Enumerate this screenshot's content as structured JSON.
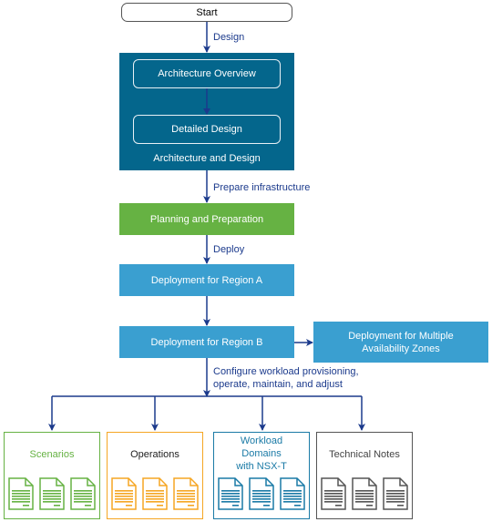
{
  "flow": {
    "start": "Start",
    "edge_design": "Design",
    "architecture_group": {
      "caption": "Architecture and Design",
      "overview": "Architecture Overview",
      "detailed": "Detailed Design"
    },
    "edge_prepare": "Prepare infrastructure",
    "planning": "Planning and Preparation",
    "edge_deploy": "Deploy",
    "region_a": "Deployment for Region A",
    "region_b": "Deployment for Region B",
    "multi_az_line1": "Deployment for Multiple",
    "multi_az_line2": "Availability Zones",
    "edge_configure_line1": "Configure workload provisioning,",
    "edge_configure_line2": "operate, maintain, and adjust"
  },
  "doc_sets": [
    {
      "title_lines": [
        "Scenarios"
      ],
      "color": "#66b243",
      "text_color": "#66b243",
      "icon": "document-icon"
    },
    {
      "title_lines": [
        "Operations"
      ],
      "color": "#f5a623",
      "text_color": "#222222",
      "icon": "document-icon"
    },
    {
      "title_lines": [
        "Workload",
        "Domains",
        "with NSX-T"
      ],
      "color": "#1a7aa6",
      "text_color": "#1a7aa6",
      "icon": "document-icon"
    },
    {
      "title_lines": [
        "Technical Notes"
      ],
      "color": "#555555",
      "text_color": "#444444",
      "icon": "document-icon"
    }
  ],
  "colors": {
    "arrow": "#1b3a8c",
    "architecture": "#04668c",
    "planning": "#66b243",
    "deployment": "#3a9fd0"
  }
}
